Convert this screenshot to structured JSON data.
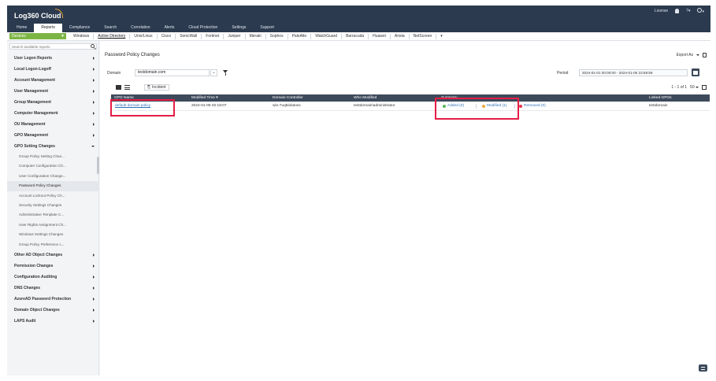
{
  "app": {
    "logo_text": "Log360 Cloud",
    "nav_tabs": [
      "Home",
      "Reports",
      "Compliance",
      "Search",
      "Correlation",
      "Alerts",
      "Cloud Protection",
      "Settings",
      "Support"
    ],
    "active_tab": "Reports",
    "top_right": {
      "license": "License",
      "help": "?",
      "help_caret": "▾",
      "user_caret": "▾"
    }
  },
  "vendor_bar": {
    "device_select": "Devices",
    "vendors": [
      "Windows",
      "Active Directory",
      "Unix/Linux",
      "Cisco",
      "SonicWall",
      "Fortinet",
      "Juniper",
      "Meraki",
      "Sophos",
      "PaloAlto",
      "WatchGuard",
      "Barracuda",
      "Huawei",
      "Arista",
      "NetScreen"
    ],
    "active_vendor": "Active Directory",
    "more_caret": "▾"
  },
  "sidebar": {
    "search_placeholder": "Search available reports",
    "items": [
      {
        "label": "User Logon Reports",
        "arrow": "right"
      },
      {
        "label": "Local Logon-Logoff",
        "arrow": "right"
      },
      {
        "label": "Account Management",
        "arrow": "right"
      },
      {
        "label": "User Management",
        "arrow": "right"
      },
      {
        "label": "Group Management",
        "arrow": "right"
      },
      {
        "label": "Computer Management",
        "arrow": "right"
      },
      {
        "label": "OU Management",
        "arrow": "right"
      },
      {
        "label": "GPO Management",
        "arrow": "right"
      },
      {
        "label": "GPO Setting Changes",
        "arrow": "down"
      }
    ],
    "sub_items": [
      "Group Policy Setting Chan...",
      "Computer Configuration Ch...",
      "User Configuration Change...",
      "Password Policy Changes",
      "Account Lockout Policy Ch...",
      "Security Settings Changes",
      "Administrative Template C...",
      "User Rights Assignment Ch...",
      "Windows Settings Changes",
      "Group Policy Preference c..."
    ],
    "active_sub": "Password Policy Changes",
    "items_after": [
      "Other AD Object Changes",
      "Permission Changes",
      "Configuration Auditing",
      "DNS Changes",
      "AzureAD Password Protection",
      "Domain Object Changes",
      "LAPS Audit"
    ]
  },
  "main": {
    "title": "Password Policy Changes",
    "export_label": "Export As",
    "domain_label": "Domain",
    "domain_value": "testdomain.com",
    "domain_chevron": "⌄",
    "period_label": "Period",
    "period_value": "2024-01-01 00:00:00 - 2024-01-05 23:59:59",
    "incident_label": "Incident",
    "pager_text": "1 - 1 of 1",
    "page_size": "50",
    "table": {
      "headers": [
        "GPO Name",
        "Modified Time",
        "Domain Controller",
        "Who Modified",
        "Summary",
        "Linked GPOs"
      ],
      "sort_indicator": "▾",
      "row": {
        "gpo_name": "default domain policy",
        "modified_time": "2024-01-05 02:18:07",
        "domain_controller": "win-7uq5iolatosx",
        "who_modified": "testdomain\\administrator",
        "summary": {
          "added": "Added (0)",
          "modified": "Modified (1)",
          "removed": "Removed (0)"
        },
        "linked_gpos": "testdomain"
      }
    }
  },
  "colors": {
    "topbar": "#2b3a4e",
    "table_header": "#3d4a5c",
    "devices_green": "#7db545",
    "highlight_red": "#e51d45",
    "added_green": "#5cb85c",
    "modified_orange": "#f0a93b",
    "removed_red": "#e2364e",
    "link_blue": "#2c6fb7"
  }
}
